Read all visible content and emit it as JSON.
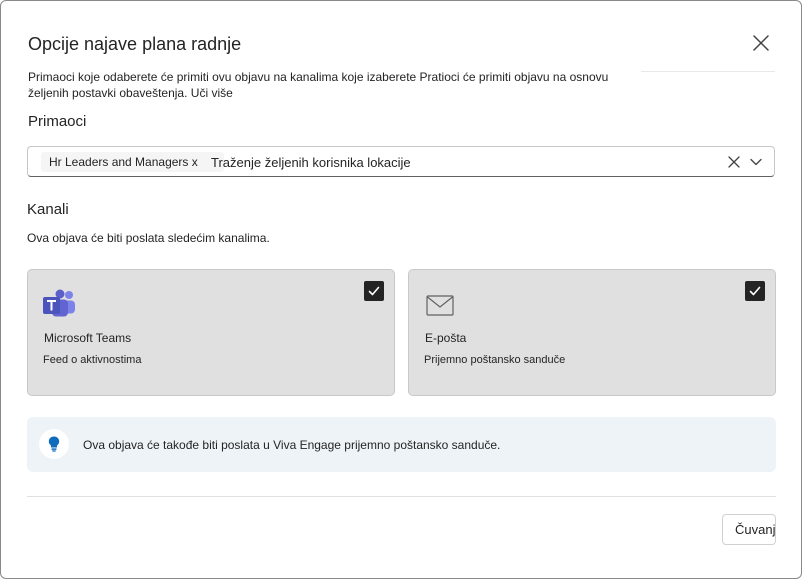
{
  "dialog": {
    "title": "Opcije najave plana radnje",
    "intro": "Primaoci koje odaberete će primiti ovu objavu na kanalima koje izaberete Pratioci će primiti objavu na osnovu željenih postavki obaveštenja.",
    "learn_more": "Uči više"
  },
  "recipients": {
    "label": "Primaoci",
    "chip": "Hr Leaders and Managers x",
    "placeholder": "Traženje željenih korisnika lokacije"
  },
  "channels": {
    "label": "Kanali",
    "description": "Ova objava će biti poslata sledećim kanalima.",
    "items": [
      {
        "name": "Microsoft Teams",
        "subtitle": "Feed o aktivnostima",
        "checked": true,
        "icon": "teams-icon"
      },
      {
        "name": "E-pošta",
        "subtitle": "Prijemno poštansko sanduče",
        "checked": true,
        "icon": "mail-icon"
      }
    ]
  },
  "info": {
    "text": "Ova objava će takođe biti poslata u Viva Engage prijemno poštansko sanduče.",
    "icon": "lightbulb-icon"
  },
  "footer": {
    "save_label": "Čuvanje"
  },
  "colors": {
    "teams_purple": "#5b5fc7",
    "bulb_blue": "#0f6cbd",
    "card_bg": "#e0e0e0",
    "info_bg": "#eef3f8"
  }
}
